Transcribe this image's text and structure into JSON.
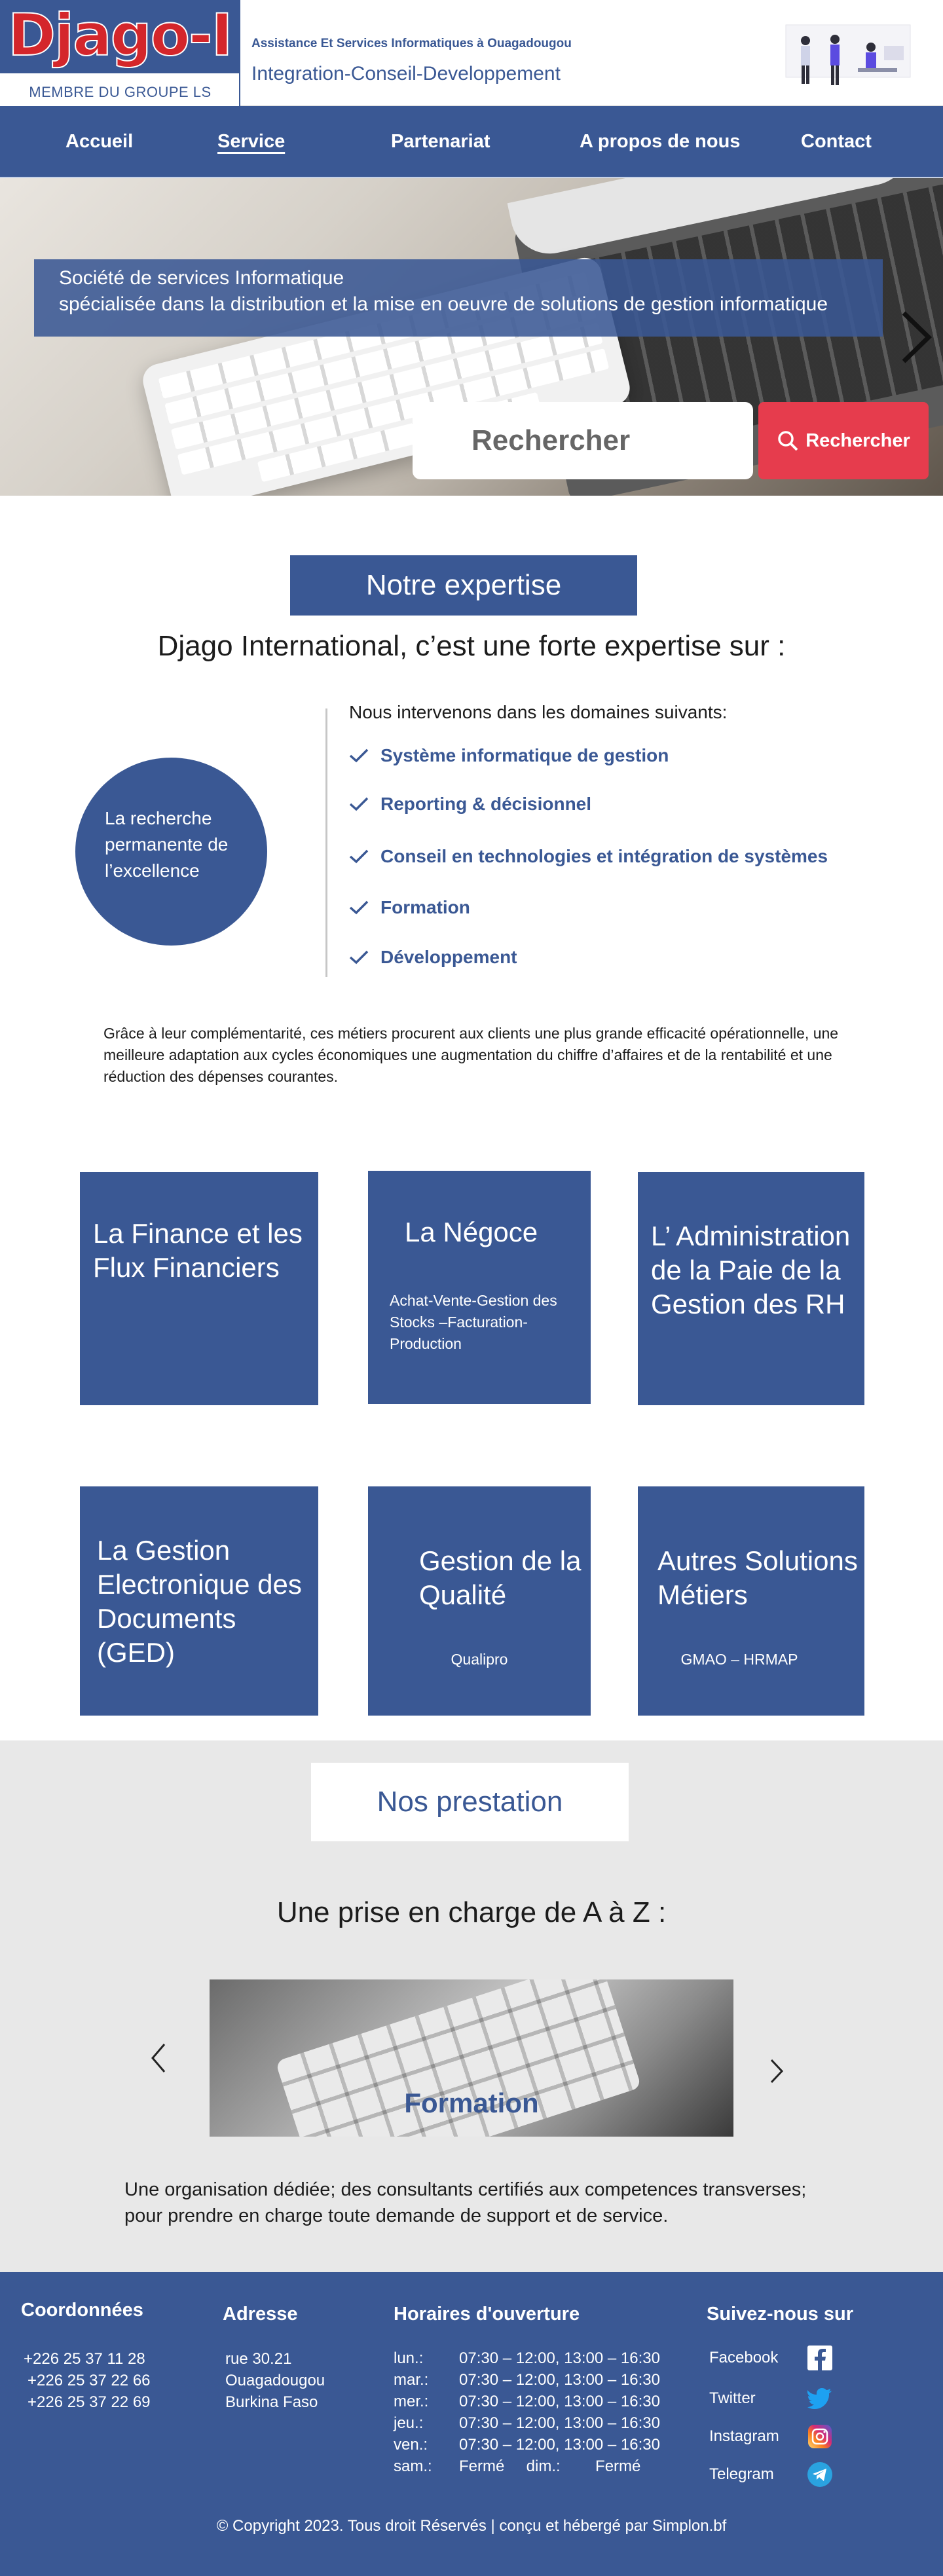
{
  "header": {
    "logo_text": "Djago-I",
    "logo_sub": "MEMBRE DU GROUPE LS",
    "tagline_small": "Assistance Et Services Informatiques à Ouagadougou",
    "tagline_main": "Integration-Conseil-Developpement"
  },
  "nav": {
    "items": [
      {
        "label": "Accueil",
        "active": false
      },
      {
        "label": "Service",
        "active": true
      },
      {
        "label": "Partenariat",
        "active": false
      },
      {
        "label": "A propos de nous",
        "active": false
      },
      {
        "label": "Contact",
        "active": false
      }
    ]
  },
  "hero": {
    "line1": "Société de services Informatique",
    "line2": "spécialisée dans la distribution et la mise en oeuvre de solutions de gestion informatique",
    "search_placeholder": "Rechercher",
    "search_button": "Rechercher"
  },
  "expertise": {
    "title": "Notre expertise",
    "subtitle": "Djago International, c’est  une forte expertise sur :",
    "circle_text": "La recherche permanente de l’excellence",
    "intro": "Nous intervenons dans les domaines suivants:",
    "domains": [
      "Système informatique de gestion",
      "Reporting & décisionnel",
      "Conseil en technologies et intégration de systèmes",
      "Formation",
      "Développement"
    ],
    "paragraph": "Grâce à leur complémentarité, ces métiers procurent aux clients une plus grande efficacité opérationnelle, une meilleure adaptation aux cycles économiques une augmentation du chiffre  d’affaires et de la rentabilité et une réduction des dépenses courantes."
  },
  "cards": [
    {
      "title": "La Finance et les Flux Financiers",
      "sub": ""
    },
    {
      "title": "La Négoce",
      "sub": "Achat-Vente-Gestion des Stocks –Facturation-Production"
    },
    {
      "title": "L’ Administration de la Paie de la Gestion des RH",
      "sub": ""
    },
    {
      "title": "La Gestion Electronique des Documents (GED)",
      "sub": ""
    },
    {
      "title": "Gestion de la Qualité",
      "sub": "Qualipro"
    },
    {
      "title": "Autres Solutions Métiers",
      "sub": "GMAO – HRMAP"
    }
  ],
  "prestation": {
    "title": "Nos prestation",
    "subtitle": "Une prise en charge de A à Z :",
    "carousel_caption": "Formation",
    "paragraph": "Une organisation dédiée; des consultants certifiés aux competences transverses; pour prendre en charge toute demande de support et de service."
  },
  "footer": {
    "coords_title": "Coordonnées",
    "phones": [
      "+226 25 37 11 28",
      "+226 25 37 22 66",
      "+226 25 37 22 69"
    ],
    "address_title": "Adresse",
    "address": [
      "rue 30.21",
      "Ouagadougou",
      "Burkina Faso"
    ],
    "hours_title": "Horaires d'ouverture",
    "hours": [
      {
        "day": "lun.:",
        "time": "07:30 – 12:00, 13:00 – 16:30"
      },
      {
        "day": "mar.:",
        "time": "07:30 – 12:00, 13:00 – 16:30"
      },
      {
        "day": "mer.:",
        "time": "07:30 – 12:00, 13:00 – 16:30"
      },
      {
        "day": "jeu.:",
        "time": "07:30 – 12:00, 13:00 – 16:30"
      },
      {
        "day": "ven.:",
        "time": "07:30 – 12:00, 13:00 – 16:30"
      },
      {
        "day": "sam.:",
        "time": "Fermé     dim.:        Fermé"
      }
    ],
    "social_title": "Suivez-nous sur",
    "social": [
      {
        "name": "Facebook",
        "icon": "facebook-icon",
        "color": "#ffffff"
      },
      {
        "name": "Twitter",
        "icon": "twitter-icon",
        "color": "#1da1f2"
      },
      {
        "name": "Instagram",
        "icon": "instagram-icon",
        "color": "#d62976"
      },
      {
        "name": "Telegram",
        "icon": "telegram-icon",
        "color": "#2aa3e0"
      }
    ],
    "copyright": "© Copyright 2023. Tous droit Réservés | conçu et hébergé par Simplon.bf"
  },
  "colors": {
    "brand_blue": "#3a5894",
    "logo_red": "#d4262b",
    "search_red": "#e63c4d"
  }
}
